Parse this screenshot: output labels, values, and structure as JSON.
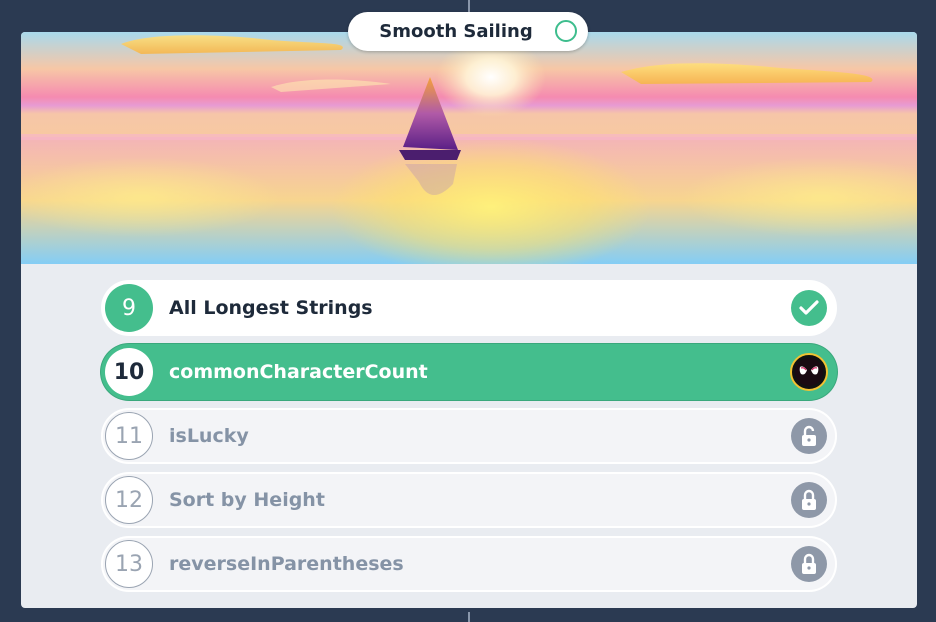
{
  "header": {
    "title": "Smooth Sailing",
    "status_icon": "circle-outline-icon"
  },
  "levels": [
    {
      "number": "9",
      "name": "All Longest Strings",
      "state": "completed",
      "icon": "check-icon"
    },
    {
      "number": "10",
      "name": "commonCharacterCount",
      "state": "current",
      "icon": "avatar"
    },
    {
      "number": "11",
      "name": "isLucky",
      "state": "locked",
      "icon": "lock-icon"
    },
    {
      "number": "12",
      "name": "Sort by Height",
      "state": "locked",
      "icon": "lock-icon"
    },
    {
      "number": "13",
      "name": "reverseInParentheses",
      "state": "locked",
      "icon": "lock-icon"
    }
  ],
  "colors": {
    "background": "#2b3a52",
    "accent": "#44be8d",
    "locked": "#8e98a8"
  }
}
